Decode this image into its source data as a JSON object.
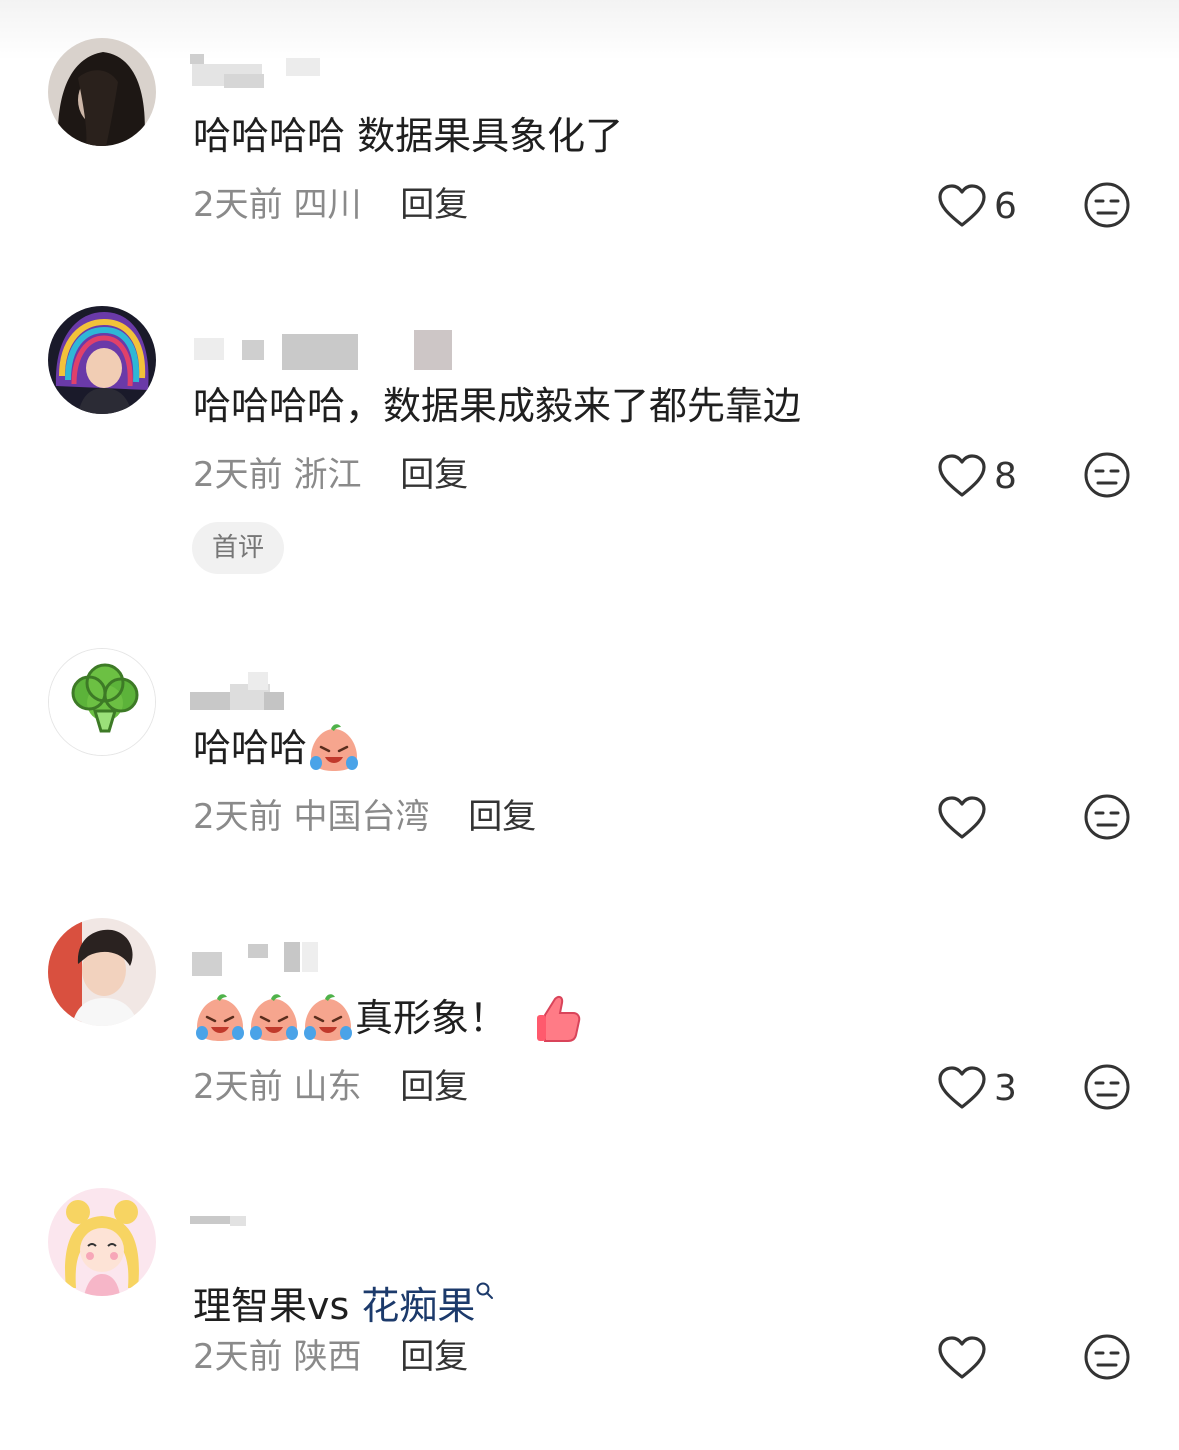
{
  "comments": [
    {
      "avatar": "dark-haired-portrait-avatar",
      "name": "",
      "text": "哈哈哈哈  数据果具象化了",
      "time": "2天前",
      "location": "四川",
      "reply_label": "回复",
      "likes": "6"
    },
    {
      "avatar": "rainbow-hair-girl-avatar",
      "name": "",
      "text": "哈哈哈哈，数据果成毅来了都先靠边",
      "time": "2天前",
      "location": "浙江",
      "reply_label": "回复",
      "likes": "8",
      "badge": "首评"
    },
    {
      "avatar": "broccoli-avatar",
      "name": "",
      "text": "哈哈哈",
      "emoji": "crying-laughing-peach-emoji",
      "time": "2天前",
      "location": "中国台湾",
      "reply_label": "回复",
      "likes": ""
    },
    {
      "avatar": "young-man-portrait-avatar",
      "name": "",
      "text": "真形象！",
      "emoji": "crying-laughing-peach-emoji",
      "emoji_trailing": "thumbs-up-emoji",
      "time": "2天前",
      "location": "山东",
      "reply_label": "回复",
      "likes": "3"
    },
    {
      "avatar": "sailor-moon-avatar",
      "name": "",
      "text_prefix": "理智果vs ",
      "text_link": "花痴果",
      "link_icon": "search-icon",
      "time": "2天前",
      "location": "陕西",
      "reply_label": "回复",
      "likes": ""
    }
  ],
  "colors": {
    "text": "#1f1f1f",
    "meta": "#8a8a8a",
    "link": "#1c3a6b",
    "badge_bg": "#f1f1f1"
  }
}
